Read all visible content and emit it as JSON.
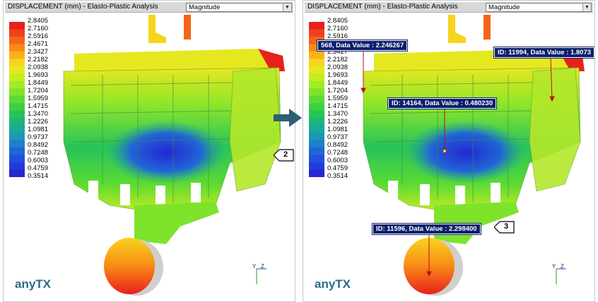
{
  "left_panel": {
    "title": "DISPLACEMENT (mm) - Elasto-Plastic Analysis",
    "dropdown_value": "Magnitude",
    "brand": "anyTX",
    "axis_y": "Y",
    "axis_z": "Z",
    "marker": "2"
  },
  "right_panel": {
    "title": "DISPLACEMENT (mm) - Elasto-Plastic Analysis",
    "dropdown_value": "Magnitude",
    "brand": "anyTX",
    "axis_y": "Y",
    "axis_z": "Z",
    "marker": "3",
    "callouts": [
      "568, Data Value : 2.246267",
      "ID: 11994, Data Value : 1.8073",
      "ID: 14164, Data Value : 0.480230",
      "ID: 11596, Data Value : 2.298400"
    ]
  },
  "legend": {
    "values": [
      "2.8405",
      "2.7160",
      "2.5916",
      "2.4671",
      "2.3427",
      "2.2182",
      "2.0938",
      "1.9693",
      "1.8449",
      "1.7204",
      "1.5959",
      "1.4715",
      "1.3470",
      "1.2226",
      "1.0981",
      "0.9737",
      "0.8492",
      "0.7248",
      "0.6003",
      "0.4759",
      "0.3514"
    ],
    "colors": [
      "#e8201c",
      "#f0411a",
      "#f56418",
      "#f98a17",
      "#fbb11a",
      "#f7d41d",
      "#e6e81f",
      "#c6ec22",
      "#a4ea25",
      "#7fe32b",
      "#5bda33",
      "#3ecf3f",
      "#27c35a",
      "#1cb67a",
      "#1aa89b",
      "#1c97b6",
      "#1f80c9",
      "#2166d6",
      "#2150db",
      "#223cdb",
      "#2228d2"
    ]
  },
  "colors": {
    "callout_bg": "#0b1f6b",
    "brand": "#2c6a88",
    "arrow": "#2f5d73"
  }
}
